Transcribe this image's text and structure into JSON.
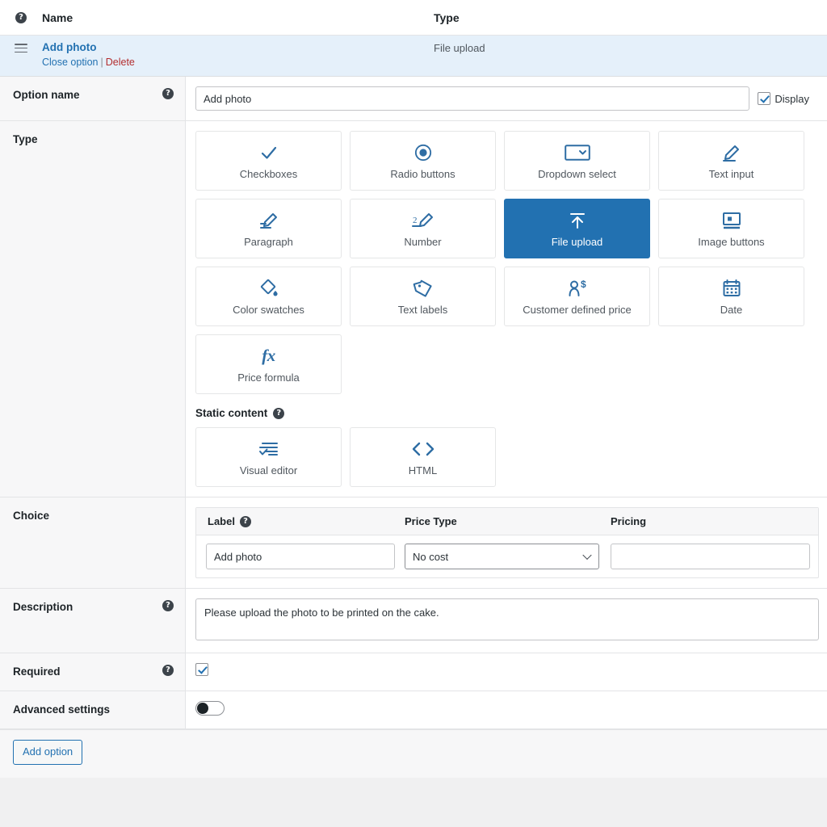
{
  "colors": {
    "accent": "#2271b1",
    "icon_blue": "#2e6da4",
    "selected_row_bg": "#e5f0fa",
    "label_bg": "#f7f7f8",
    "danger": "#b32d2e"
  },
  "header": {
    "help_icon": "help-icon",
    "name_col": "Name",
    "type_col": "Type"
  },
  "option_row": {
    "drag_handle": "drag-handle-icon",
    "title": "Add photo",
    "close_label": "Close option",
    "separator": "|",
    "delete_label": "Delete",
    "type_value": "File upload"
  },
  "option_name": {
    "label": "Option name",
    "value": "Add photo",
    "placeholder": "Add photo",
    "display_label": "Display",
    "display_checked": true
  },
  "type_section": {
    "label": "Type",
    "selected": "File upload",
    "cards": [
      {
        "label": "Checkboxes",
        "icon": "check-icon"
      },
      {
        "label": "Radio buttons",
        "icon": "radio-icon"
      },
      {
        "label": "Dropdown select",
        "icon": "dropdown-icon"
      },
      {
        "label": "Text input",
        "icon": "pencil-line-icon"
      },
      {
        "label": "Paragraph",
        "icon": "pencil-lines-icon"
      },
      {
        "label": "Number",
        "icon": "pencil-number-icon"
      },
      {
        "label": "File upload",
        "icon": "upload-icon"
      },
      {
        "label": "Image buttons",
        "icon": "image-button-icon"
      },
      {
        "label": "Color swatches",
        "icon": "paint-bucket-icon"
      },
      {
        "label": "Text labels",
        "icon": "tag-icon"
      },
      {
        "label": "Customer defined price",
        "icon": "person-dollar-icon"
      },
      {
        "label": "Date",
        "icon": "calendar-icon"
      },
      {
        "label": "Price formula",
        "icon": "fx-icon"
      }
    ],
    "static_content": {
      "heading": "Static content",
      "help_icon": "help-icon",
      "cards": [
        {
          "label": "Visual editor",
          "icon": "visual-editor-icon"
        },
        {
          "label": "HTML",
          "icon": "code-brackets-icon"
        }
      ]
    }
  },
  "choice": {
    "label": "Choice",
    "columns": {
      "label": "Label",
      "price_type": "Price Type",
      "pricing": "Pricing"
    },
    "rows": [
      {
        "label_value": "Add photo",
        "price_type_value": "No cost",
        "pricing_value": ""
      }
    ]
  },
  "description": {
    "label": "Description",
    "value": "Please upload the photo to be printed on the cake."
  },
  "required": {
    "label": "Required",
    "checked": true
  },
  "advanced": {
    "label": "Advanced settings",
    "enabled": false
  },
  "footer": {
    "add_option_label": "Add option"
  }
}
